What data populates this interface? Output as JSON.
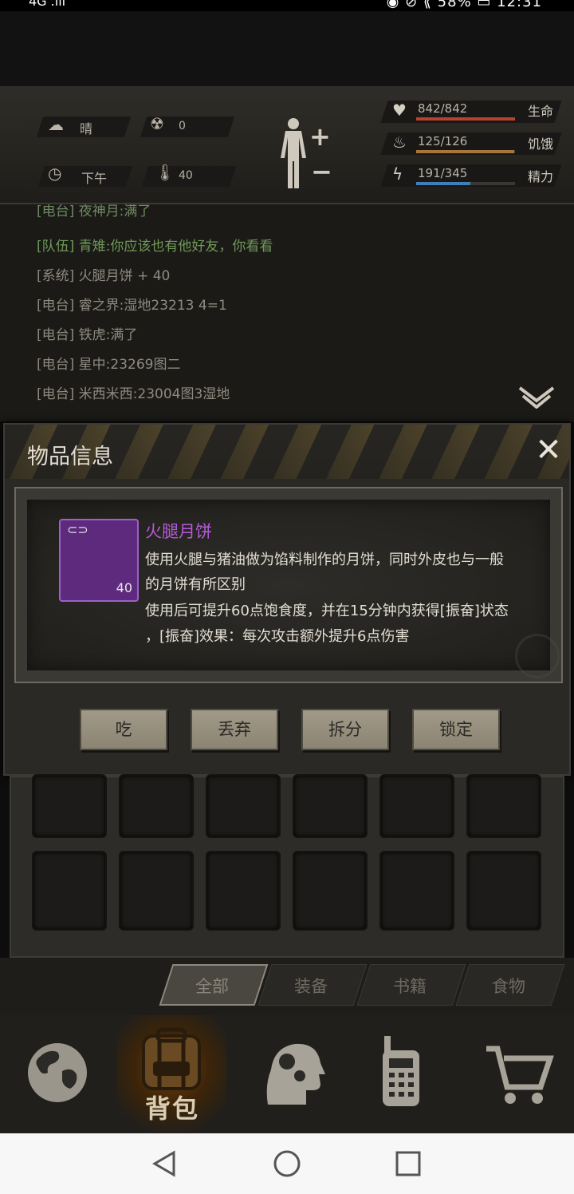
{
  "status_bar": {
    "left": "4G .ıll",
    "right": "◉ ⊘ ⟪ 58% ▭ 12:31"
  },
  "environment": {
    "weather": "晴",
    "radiation": "0",
    "time_of_day": "下午",
    "temperature": "40"
  },
  "vitals": [
    {
      "label": "生命",
      "value": "842/842",
      "fraction": 1.0,
      "color": "#b8412f",
      "icon": "heart-icon"
    },
    {
      "label": "饥饿",
      "value": "125/126",
      "fraction": 0.99,
      "color": "#a8753a",
      "icon": "stomach-icon"
    },
    {
      "label": "精力",
      "value": "191/345",
      "fraction": 0.55,
      "color": "#3f7fb7",
      "icon": "energy-icon"
    }
  ],
  "chat": {
    "lines": [
      {
        "text": "[电台] 夜神月:满了",
        "color": "#6e8a62"
      },
      {
        "text": "[队伍] 青雉:你应该也有他好友，你看看",
        "color": "#6f9a58"
      },
      {
        "text": "[系统] 火腿月饼 + 40",
        "color": "#8f8a80"
      },
      {
        "text": "[电台] 睿之界:湿地23213 4=1",
        "color": "#8f8a80"
      },
      {
        "text": "[电台] 铁虎:满了",
        "color": "#8f8a80"
      },
      {
        "text": "[电台] 星中:23269图二",
        "color": "#8f8a80"
      },
      {
        "text": "[电台] 米西米西:23004图3湿地",
        "color": "#8f8a80"
      }
    ]
  },
  "dialog": {
    "title": "物品信息",
    "close_symbol": "✕",
    "item": {
      "name": "火腿月饼",
      "quantity": "40",
      "description_lines": [
        "使用火腿与猪油做为馅料制作的月饼，同时外皮也与一般",
        "的月饼有所区别",
        "使用后可提升60点饱食度，并在15分钟内获得[振奋]状态",
        "，[振奋]效果：每次攻击额外提升6点伤害"
      ]
    },
    "actions": [
      "吃",
      "丢弃",
      "拆分",
      "锁定"
    ]
  },
  "inventory_tabs": [
    {
      "label": "全部",
      "active": true
    },
    {
      "label": "装备",
      "active": false
    },
    {
      "label": "书籍",
      "active": false
    },
    {
      "label": "食物",
      "active": false
    }
  ],
  "bottom_nav": {
    "items": [
      "globe-icon",
      "backpack-icon",
      "brain-head-icon",
      "radio-icon",
      "cart-icon"
    ],
    "active_label": "背包"
  }
}
